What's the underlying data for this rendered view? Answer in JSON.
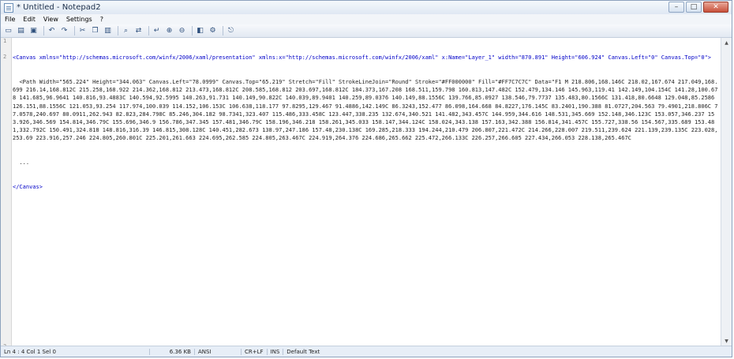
{
  "window": {
    "title": "* Untitled - Notepad2"
  },
  "controls": {
    "minimize": "–",
    "maximize": "□",
    "close": "✕"
  },
  "menu": [
    "File",
    "Edit",
    "View",
    "Settings",
    "?"
  ],
  "toolbar": [
    "new-icon",
    "open-icon",
    "save-icon",
    "undo-icon",
    "redo-icon",
    "cut-icon",
    "copy-icon",
    "paste-icon",
    "find-icon",
    "replace-icon",
    "wordwrap-icon",
    "zoom-in-icon",
    "zoom-out-icon",
    "scheme-icon",
    "settings-icon",
    "exit-icon"
  ],
  "lines": [
    "<Canvas xmlns=\"http://schemas.microsoft.com/winfx/2006/xaml/presentation\" xmlns:x=\"http://schemas.microsoft.com/winfx/2006/xaml\" x:Name=\"Layer_1\" width=\"870.891\" Height=\"606.924\" Canvas.Left=\"0\" Canvas.Top=\"0\">",
    "  <Path Width=\"565.224\" Height=\"344.063\" Canvas.Left=\"78.0999\" Canvas.Top=\"65.219\" Stretch=\"Fill\" StrokeLineJoin=\"Round\" Stroke=\"#FF000000\" Fill=\"#FF7C7C7C\" Data=\"F1 M 218.806,168.146C 218.02,167.674 217.049,168.699 216.14,168.812C 215.258,168.922 214.362,168.812 213.473,168.812C 208.585,168.812 203.697,168.812C 184.373,167.208 168.511,159.798 160.813,147.482C 152.479,134.146 145.963,119.41 142.149,104.154C 141.28,100.678 141.685,96.9641 140.816,93.4883C 140.594,92.5995 140.263,91.731 140.149,90.822C 140.039,89.9401 140.259,89.0376 140.149,88.1556C 139.766,85.0927 138.546,79.7737 135.483,80.1566C 131.418,80.6648 129.048,85.2586 126.151,88.1556C 121.053,93.254 117.974,100.039 114.152,106.153C 106.638,118.177 97.8295,129.467 91.4886,142.149C 86.3243,152.477 86.098,164.668 84.8227,176.145C 83.2401,190.388 81.0727,204.563 79.4901,218.806C 77.0578,240.697 80.0911,262.943 82.823,284.798C 85.246,304.182 98.7341,323.407 115.486,333.458C 123.447,338.235 132.674,340.521 141.482,343.457C 144.959,344.616 148.531,345.669 152.148,346.123C 153.057,346.237 153.926,346.569 154.814,346.79C 155.696,346.9 156.786,347.345 157.481,346.79C 158.196,346.218 158.261,345.033 158.147,344.124C 158.024,343.138 157.163,342.388 156.814,341.457C 155.727,338.56 154.567,335.689 153.481,332.792C 150.491,324.818 148.816,316.39 146.815,308.128C 140.451,282.673 138.97,247.186 157.48,230.138C 169.285,218.333 194.244,210.479 206.807,221.472C 214.266,228.007 219.511,239.624 221.139,239.135C 223.028,253.69 223.916,257.246 224.805,260.801C 225.201,261.663 224.695,262.585 224.805,263.467C 224.919,264.376 224.686,265.662 225.472,266.133C 226.257,266.605 227.434,266.053 228.138,265.467C",
    "  ...",
    "</Canvas>"
  ],
  "status": {
    "position": "Ln 4 : 4   Col 1   Sel 0",
    "size": "6.36 KB",
    "encoding": "ANSI",
    "eol": "CR+LF",
    "mode": "INS",
    "scheme": "Default Text"
  }
}
